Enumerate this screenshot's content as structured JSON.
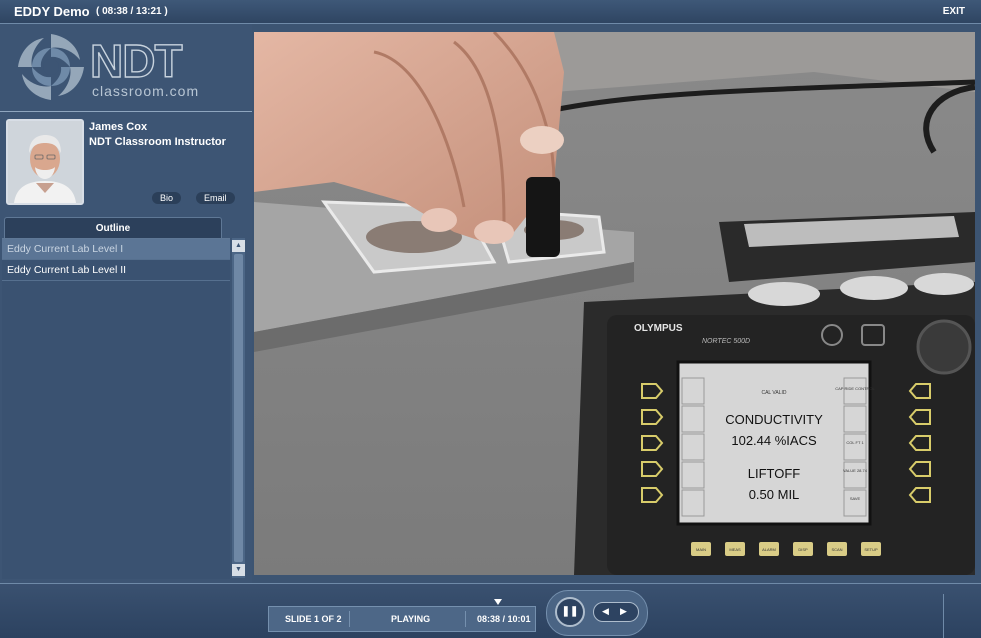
{
  "header": {
    "title": "EDDY Demo",
    "time": "( 08:38 / 13:21 )",
    "exit_label": "EXIT"
  },
  "logo": {
    "brand": "NDT",
    "sub": "classroom.com"
  },
  "instructor": {
    "name": "James Cox",
    "role": "NDT Classroom Instructor",
    "bio_label": "Bio",
    "email_label": "Email"
  },
  "outline": {
    "tab_label": "Outline",
    "items": [
      {
        "label": "Eddy Current Lab Level I"
      },
      {
        "label": "Eddy Current Lab Level II"
      }
    ]
  },
  "device": {
    "brand": "OLYMPUS",
    "model": "NORTEC 500D",
    "screen_top": "CAL VALID",
    "conductivity_label": "CONDUCTIVITY",
    "conductivity_value": "102.44 %IACS",
    "liftoff_label": "LIFTOFF",
    "liftoff_value": "0.50 MIL",
    "soft_right": [
      "CAP RIDE CONTROL",
      "COL FT 1",
      "VALUE 28.74",
      "SAVE"
    ],
    "bottom_buttons": [
      "MAIN",
      "MEAS",
      "ALARM",
      "DISP",
      "SCAN",
      "SETUP"
    ]
  },
  "player": {
    "slide": "SLIDE 1 OF 2",
    "state": "PLAYING",
    "time": "08:38 / 10:01",
    "progress": 0.862
  },
  "colors": {
    "background": "#3c5472",
    "panel": "#4d6787"
  }
}
